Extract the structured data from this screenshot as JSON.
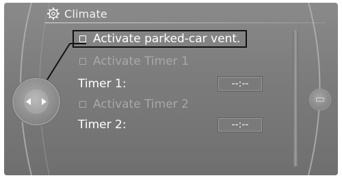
{
  "header": {
    "title": "Climate",
    "icon": "climate-settings-icon"
  },
  "menu": {
    "activate_parked_vent": {
      "label": "Activate parked-car vent.",
      "checked": false,
      "selected": true,
      "enabled": true
    },
    "activate_timer_1": {
      "label": "Activate Timer 1",
      "checked": false,
      "enabled": false
    },
    "timer_1": {
      "label": "Timer 1:",
      "value": "--:--"
    },
    "activate_timer_2": {
      "label": "Activate Timer 2",
      "checked": false,
      "enabled": false
    },
    "timer_2": {
      "label": "Timer 2:",
      "value": "--:--"
    }
  },
  "colors": {
    "background": "#7d7d7d",
    "text": "#ffffff",
    "disabled_text": "#a9a9a9",
    "highlight_border": "#111111"
  }
}
